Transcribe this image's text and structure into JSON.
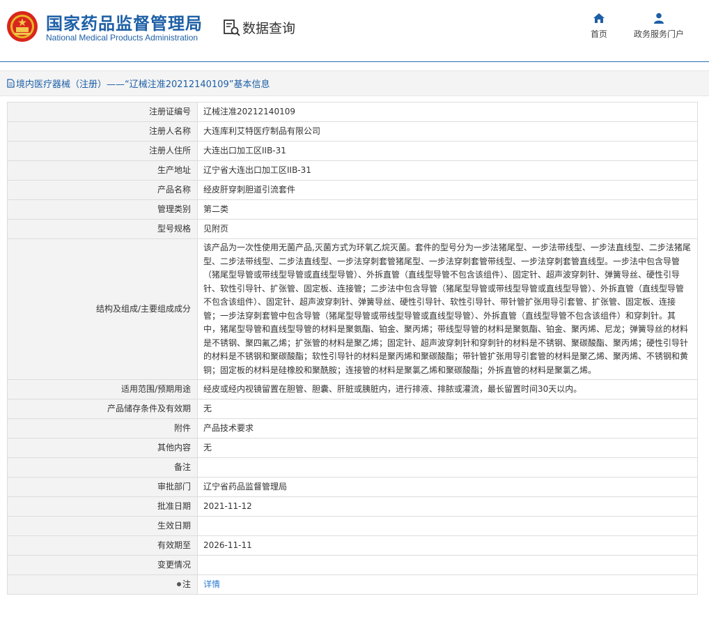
{
  "header": {
    "title_cn": "国家药品监督管理局",
    "title_en": "National Medical Products Administration",
    "query_label": "数据查询",
    "nav": [
      {
        "label": "首页",
        "icon": "home-icon"
      },
      {
        "label": "政务服务门户",
        "icon": "user-icon"
      }
    ]
  },
  "breadcrumb": "境内医疗器械（注册）——“辽械注准20212140109”基本信息",
  "rows": [
    {
      "label": "注册证编号",
      "value": "辽械注准20212140109"
    },
    {
      "label": "注册人名称",
      "value": "大连库利艾特医疗制品有限公司"
    },
    {
      "label": "注册人住所",
      "value": "大连出口加工区IIB-31"
    },
    {
      "label": "生产地址",
      "value": "辽宁省大连出口加工区IIB-31"
    },
    {
      "label": "产品名称",
      "value": "经皮肝穿刺胆道引流套件"
    },
    {
      "label": "管理类别",
      "value": "第二类"
    },
    {
      "label": "型号规格",
      "value": "见附页"
    },
    {
      "label": "结构及组成/主要组成成分",
      "value": "该产品为一次性使用无菌产品,灭菌方式为环氧乙烷灭菌。套件的型号分为一步法猪尾型、一步法带线型、一步法直线型、二步法猪尾型、二步法带线型、二步法直线型、一步法穿刺套管猪尾型、一步法穿刺套管带线型、一步法穿刺套管直线型。一步法中包含导管（猪尾型导管或带线型导管或直线型导管）、外拆直管（直线型导管不包含该组件）、固定针、超声波穿刺针、弹簧导丝、硬性引导针、软性引导针、扩张管、固定板、连接管；二步法中包含导管（猪尾型导管或带线型导管或直线型导管）、外拆直管（直线型导管不包含该组件）、固定针、超声波穿刺针、弹簧导丝、硬性引导针、软性引导针、带针管扩张用导引套管、扩张管、固定板、连接管；一步法穿刺套管中包含导管（猪尾型导管或带线型导管或直线型导管）、外拆直管（直线型导管不包含该组件）和穿刺针。其中，猪尾型导管和直线型导管的材料是聚氨酯、铂金、聚丙烯；带线型导管的材料是聚氨酯、铂金、聚丙烯、尼龙；弹簧导丝的材料是不锈钢、聚四氟乙烯；扩张管的材料是聚乙烯；固定针、超声波穿刺针和穿刺针的材料是不锈钢、聚碳酸酯、聚丙烯；硬性引导针的材料是不锈钢和聚碳酸酯；软性引导针的材料是聚丙烯和聚碳酸酯；带针管扩张用导引套管的材料是聚乙烯、聚丙烯、不锈钢和黄铜；固定板的材料是硅橡胶和聚酰胺；连接管的材料是聚氯乙烯和聚碳酸酯；外拆直管的材料是聚氯乙烯。"
    },
    {
      "label": "适用范围/预期用途",
      "value": "经皮或经内视镜留置在胆管、胆囊、肝脏或胰脏内，进行排液、排脓或灌流，最长留置时间30天以内。"
    },
    {
      "label": "产品储存条件及有效期",
      "value": "无"
    },
    {
      "label": "附件",
      "value": "产品技术要求"
    },
    {
      "label": "其他内容",
      "value": "无"
    },
    {
      "label": "备注",
      "value": ""
    },
    {
      "label": "审批部门",
      "value": "辽宁省药品监督管理局"
    },
    {
      "label": "批准日期",
      "value": "2021-11-12"
    },
    {
      "label": "生效日期",
      "value": ""
    },
    {
      "label": "有效期至",
      "value": "2026-11-11"
    },
    {
      "label": "变更情况",
      "value": ""
    },
    {
      "label": "注",
      "value": "详情"
    }
  ],
  "colors": {
    "brand": "#1d5fa6",
    "link": "#2a7bd3",
    "label_bg": "#f3f3f3"
  }
}
